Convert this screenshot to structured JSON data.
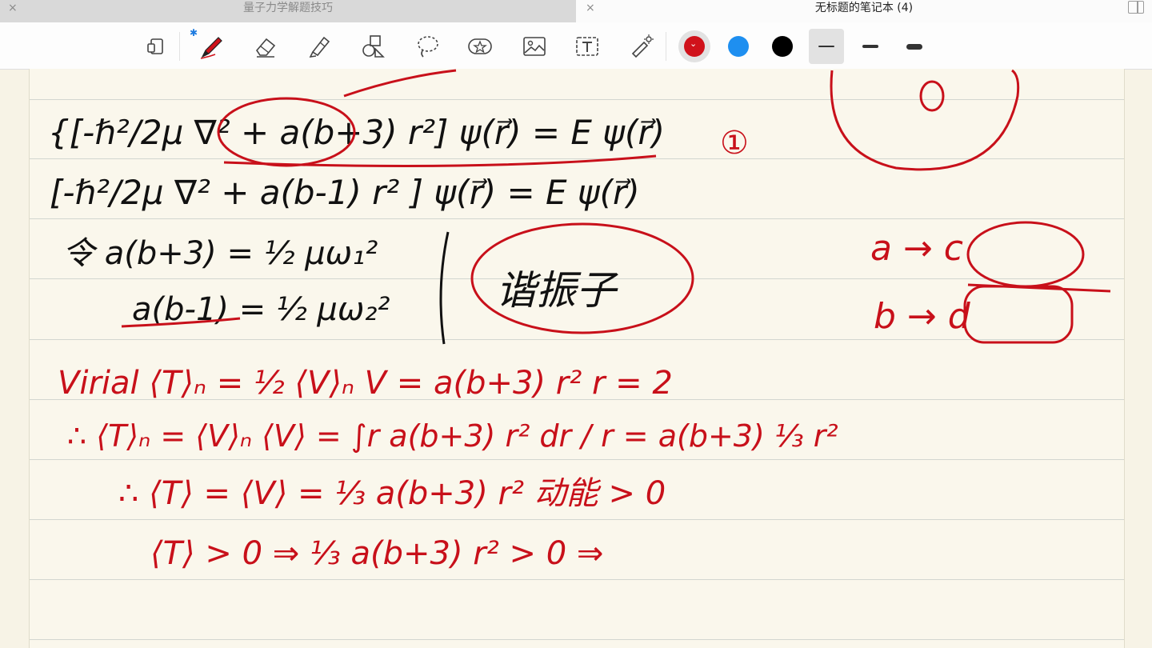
{
  "tabs": [
    {
      "title": "量子力学解题技巧",
      "active": false
    },
    {
      "title": "无标题的笔记本 (4)",
      "active": true
    }
  ],
  "tab_close_glyph": "×",
  "toolbar": {
    "tools": [
      "lasso-select-icon",
      "pen-icon",
      "eraser-icon",
      "highlighter-icon",
      "shapes-icon",
      "lasso-icon",
      "sticker-icon",
      "image-icon",
      "text-box-icon",
      "laser-pointer-icon"
    ],
    "colors": [
      "#d0121b",
      "#1e8ff0",
      "#000000"
    ],
    "selected_color": "#d0121b",
    "stroke_widths": [
      "thin",
      "medium",
      "thick"
    ],
    "selected_width": "thin"
  },
  "notes": {
    "black_lines": [
      "{[-ℏ²/2μ ∇² + a(b+3) r²] ψ(r⃗) = E ψ(r⃗)",
      "[-ℏ²/2μ ∇² + a(b-1) r² ] ψ(r⃗) = E ψ(r⃗)",
      "令  a(b+3) = ½ μω₁²",
      "a(b-1) = ½ μω₂²",
      "谐振子"
    ],
    "red_lines": [
      "Virial  ⟨T⟩ₙ = ½ ⟨V⟩ₙ     V = a(b+3) r²   r = 2",
      "∴ ⟨T⟩ₙ = ⟨V⟩ₙ    ⟨V⟩ = ∫r a(b+3) r² dr / r = a(b+3) ⅓ r²",
      "∴ ⟨T⟩ = ⟨V⟩ = ⅓ a(b+3) r²   动能 > 0",
      "⟨T⟩ > 0 ⇒ ⅓ a(b+3) r² > 0 ⇒"
    ],
    "side": [
      "①",
      "a → c",
      "b → d"
    ]
  }
}
